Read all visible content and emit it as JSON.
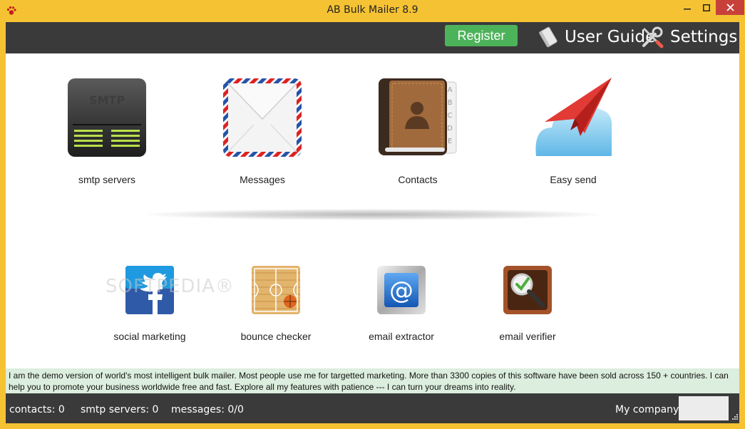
{
  "window": {
    "title": "AB Bulk Mailer 8.9",
    "app_icon": "paw-icon",
    "controls": [
      "minimize-icon",
      "maximize-icon",
      "close-icon"
    ]
  },
  "topbar": {
    "register_label": "Register",
    "user_guide_label": "User Guide",
    "settings_label": "Settings"
  },
  "tiles_row1": [
    {
      "label": "smtp servers",
      "icon": "smtp-server-icon"
    },
    {
      "label": "Messages",
      "icon": "envelope-icon"
    },
    {
      "label": "Contacts",
      "icon": "address-book-icon"
    },
    {
      "label": "Easy send",
      "icon": "paper-plane-icon"
    }
  ],
  "tiles_row2": [
    {
      "label": "social marketing",
      "icon": "social-icon"
    },
    {
      "label": "bounce checker",
      "icon": "basketball-court-icon"
    },
    {
      "label": "email extractor",
      "icon": "at-sign-icon"
    },
    {
      "label": "email verifier",
      "icon": "magnifier-check-icon"
    }
  ],
  "watermark": "SOFTPEDIA®",
  "info_text": " I am the demo version of world's most intelligent bulk mailer. Most people use me for targetted marketing. More than 3300 copies of this software have been sold across 150 + countries. I can help you to promote your business worldwide free and fast. Explore all my features with patience --- I can turn your dreams into reality.",
  "status": {
    "contacts": "contacts: 0",
    "smtp_servers": "smtp servers: 0",
    "messages": "messages: 0/0",
    "company": "My company"
  },
  "colors": {
    "titlebar": "#f5c233",
    "dark_bar": "#3a3a3a",
    "register_green": "#4db35a",
    "info_bg": "#dceedd",
    "close_red": "#c7413a"
  }
}
